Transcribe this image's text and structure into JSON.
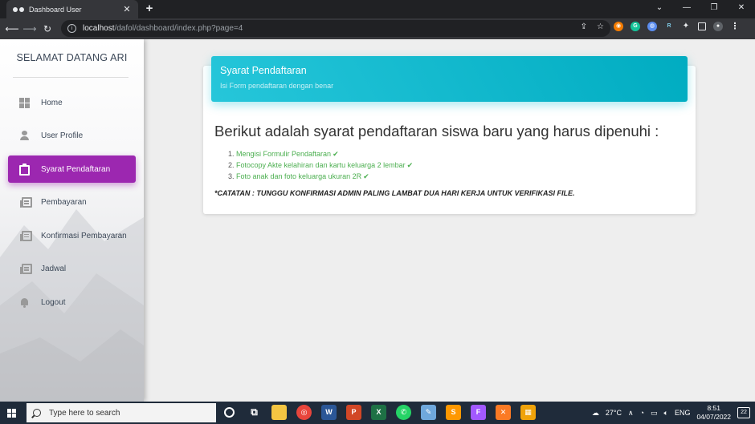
{
  "browser": {
    "tab_title": "Dashboard User",
    "tab_close": "✕",
    "new_tab": "+",
    "url_host": "localhost",
    "url_path": "/dafol/dashboard/index.php?page=4",
    "window_controls": [
      "⌄",
      "—",
      "❐",
      "✕"
    ]
  },
  "sidebar": {
    "brand": "SELAMAT DATANG ARI",
    "items": [
      {
        "label": "Home",
        "icon": "dashboard-icon",
        "active": false
      },
      {
        "label": "User Profile",
        "icon": "person-icon",
        "active": false
      },
      {
        "label": "Syarat Pendaftaran",
        "icon": "clipboard-icon",
        "active": true
      },
      {
        "label": "Pembayaran",
        "icon": "library-books-icon",
        "active": false
      },
      {
        "label": "Konfirmasi Pembayaran",
        "icon": "library-books-icon",
        "active": false
      },
      {
        "label": "Jadwal",
        "icon": "library-books-icon",
        "active": false
      },
      {
        "label": "Logout",
        "icon": "bell-icon",
        "active": false
      }
    ]
  },
  "card": {
    "title": "Syarat Pendaftaran",
    "subtitle": "Isi Form pendaftaran dengan benar",
    "heading": "Berikut adalah syarat pendaftaran siswa baru yang harus dipenuhi :",
    "requirements": [
      {
        "num": "1.",
        "text": "Mengisi Formulir Pendaftaran"
      },
      {
        "num": "2.",
        "text": "Fotocopy Akte kelahiran dan kartu keluarga 2 lembar"
      },
      {
        "num": "3.",
        "text": "Foto anak dan foto keluarga ukuran 2R"
      }
    ],
    "check_glyph": "✔",
    "note": "*CATATAN : TUNGGU KONFIRMASI ADMIN PALING LAMBAT DUA HARI KERJA UNTUK VERIFIKASI FILE."
  },
  "taskbar": {
    "search_placeholder": "Type here to search",
    "weather": "27°C",
    "language": "ENG",
    "time": "8:51",
    "date": "04/07/2022",
    "notifications": "22"
  },
  "colors": {
    "active_menu": "#9c27b0",
    "card_header": "#00bcd4",
    "requirement_text": "#4caf50"
  }
}
